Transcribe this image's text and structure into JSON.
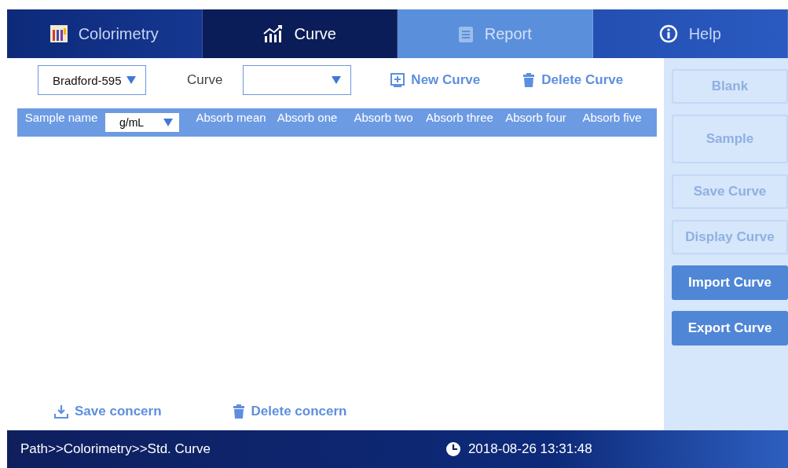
{
  "tabs": [
    {
      "label": "Colorimetry",
      "selected": false,
      "disabled": false
    },
    {
      "label": "Curve",
      "selected": true,
      "disabled": false
    },
    {
      "label": "Report",
      "selected": false,
      "disabled": true
    },
    {
      "label": "Help",
      "selected": false,
      "disabled": false
    }
  ],
  "toolbar": {
    "method": {
      "value": "Bradford-595"
    },
    "curve_label": "Curve",
    "new_curve": "New Curve",
    "delete_curve": "Delete Curve"
  },
  "table": {
    "sample_name": "Sample name",
    "unit": "g/mL",
    "columns": [
      "Absorb mean",
      "Absorb one",
      "Absorb two",
      "Absorb three",
      "Absorb four",
      "Absorb five"
    ]
  },
  "bottom_actions": [
    {
      "label": "Save concern"
    },
    {
      "label": "Delete concern"
    }
  ],
  "side_buttons": [
    {
      "label": "Blank",
      "disabled": true
    },
    {
      "label": "Sample",
      "disabled": true
    },
    {
      "label": "Save Curve",
      "disabled": true
    },
    {
      "label": "Display Curve",
      "disabled": true
    },
    {
      "label": "Import Curve",
      "disabled": false
    },
    {
      "label": "Export Curve",
      "disabled": false
    }
  ],
  "status_bar": {
    "path": "Path>>Colorimetry>>Std. Curve",
    "datetime": "2018-08-26 13:31:48"
  }
}
